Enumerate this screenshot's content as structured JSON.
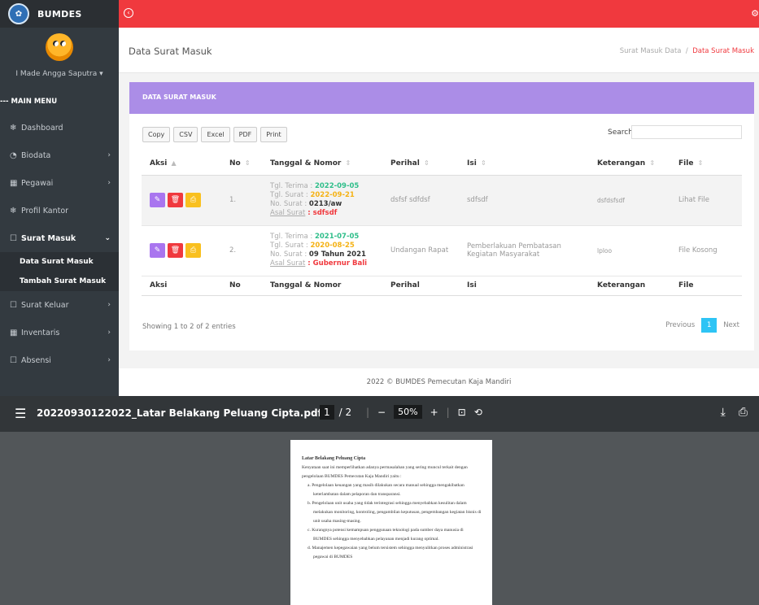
{
  "app": {
    "brand": "BUMDES",
    "user": "I Made Angga Saputra",
    "menu_header": "--- MAIN MENU",
    "nav": [
      {
        "label": "Dashboard",
        "icon": "tag-icon",
        "glyph": "❄"
      },
      {
        "label": "Biodata",
        "icon": "clock-icon",
        "glyph": "◔"
      },
      {
        "label": "Pegawai",
        "icon": "table-icon",
        "glyph": "▦"
      },
      {
        "label": "Profil Kantor",
        "icon": "tag-icon",
        "glyph": "❄"
      },
      {
        "label": "Surat Masuk",
        "icon": "inbox-icon",
        "glyph": "☐"
      },
      {
        "label": "Surat Keluar",
        "icon": "inbox-icon",
        "glyph": "☐"
      },
      {
        "label": "Inventaris",
        "icon": "table-icon",
        "glyph": "▦"
      },
      {
        "label": "Absensi",
        "icon": "inbox-icon",
        "glyph": "☐"
      }
    ],
    "submenu": [
      "Data Surat Masuk",
      "Tambah Surat Masuk"
    ],
    "page_title": "Data Surat Masuk",
    "breadcrumb": {
      "parent": "Surat Masuk Data",
      "sep": "/",
      "current": "Data Surat Masuk"
    },
    "card_title": "DATA SURAT MASUK",
    "tools": [
      "Copy",
      "CSV",
      "Excel",
      "PDF",
      "Print"
    ],
    "search_label": "Search:",
    "columns": [
      "Aksi",
      "No",
      "Tanggal & Nomor",
      "Perihal",
      "Isi",
      "Keterangan",
      "File"
    ],
    "rows": [
      {
        "no": "1.",
        "tgl_terima_label": "Tgl. Terima : ",
        "tgl_terima": "2022-09-05",
        "tgl_surat_label": "Tgl. Surat : ",
        "tgl_surat": "2022-09-21",
        "no_surat_label": "No. Surat : ",
        "no_surat": "0213/aw",
        "asal_label": "Asal Surat",
        "asal": " : sdfsdf",
        "perihal": "dsfsf sdfdsf",
        "isi": "sdfsdf",
        "keterangan": "dsfdsfsdf",
        "file": "Lihat File"
      },
      {
        "no": "2.",
        "tgl_terima_label": "Tgl. Terima : ",
        "tgl_terima": "2021-07-05",
        "tgl_surat_label": "Tgl. Surat : ",
        "tgl_surat": "2020-08-25",
        "no_surat_label": "No. Surat : ",
        "no_surat": "09 Tahun 2021",
        "asal_label": "Asal Surat",
        "asal": " : Gubernur Bali",
        "perihal": "Undangan Rapat",
        "isi": "Pemberlakuan Pembatasan Kegiatan Masyarakat",
        "keterangan": "lploo",
        "file": "File Kosong"
      }
    ],
    "showing": "Showing 1 to 2 of 2 entries",
    "pager": {
      "prev": "Previous",
      "page": "1",
      "next": "Next"
    },
    "footer": "2022 © BUMDES Pemecutan Kaja Mandiri",
    "colors": {
      "topbar": "#f0393e",
      "card_head": "#ab8de7",
      "sidebar": "#333a40"
    }
  },
  "pdf": {
    "filename": "20220930122022_Latar Belakang Peluang Cipta.pdf",
    "page_current": "1",
    "page_total": "/ 2",
    "zoom": "50%",
    "doc_title": "Latar Belakang Peluang Cipta",
    "intro": "Kenyataan saat ini memperlihatkan adanya permasalahan yang sering muncul terkait dengan pengelolaan BUMDES Pemecutan Kaja Mandiri yaitu :",
    "items": [
      {
        "marker": "a.",
        "text": "Pengelolaan keuangan yang masih dilakukan secara manual sehingga mengakibatkan keterlambatan dalam pelaporan dan transparansi."
      },
      {
        "marker": "b.",
        "text": "Pengelolaan unit usaha yang tidak terintegrasi sehingga menyebabkan kesulitan dalam melakukan monitoring, kontroling, pengambilan keputusan, pengembangan kegiatan bisnis di unit usaha masing-masing."
      },
      {
        "marker": "c.",
        "text": "Kurangnya potensi kemampuan penggunaan teknologi pada sumber daya manusia di BUMDES sehingga menyebabkan pelayanan menjadi kurang optimal."
      },
      {
        "marker": "d.",
        "text": "Manajemen kepegawaian yang belum tersistem sehingga menyulitkan proses administrasi pegawai di BUMDES"
      }
    ]
  }
}
